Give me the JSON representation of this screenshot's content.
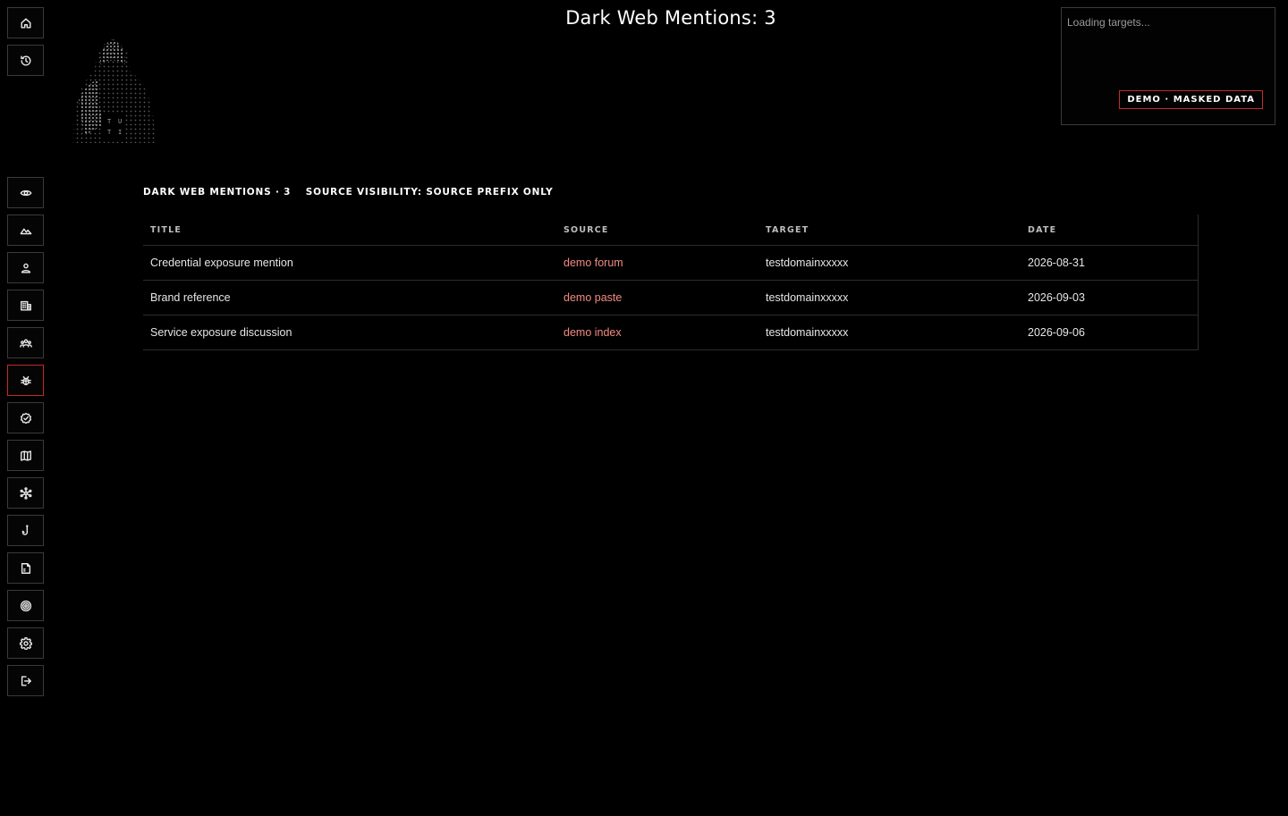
{
  "header": {
    "title": "Dark Web Mentions: 3"
  },
  "sidebar": {
    "top_items": [
      {
        "name": "home",
        "icon": "home-icon"
      },
      {
        "name": "history",
        "icon": "history-icon"
      }
    ],
    "items": [
      {
        "name": "monitoring",
        "icon": "eye-icon"
      },
      {
        "name": "landscape",
        "icon": "mountain-icon"
      },
      {
        "name": "person",
        "icon": "person-icon"
      },
      {
        "name": "organization",
        "icon": "building-icon"
      },
      {
        "name": "groups",
        "icon": "group-icon"
      },
      {
        "name": "dark-web",
        "icon": "bug-icon",
        "active": true
      },
      {
        "name": "verified",
        "icon": "verified-icon"
      },
      {
        "name": "map",
        "icon": "map-icon"
      },
      {
        "name": "network",
        "icon": "network-icon"
      },
      {
        "name": "phishing",
        "icon": "hook-icon"
      },
      {
        "name": "file",
        "icon": "file-icon"
      },
      {
        "name": "target",
        "icon": "target-icon"
      },
      {
        "name": "settings",
        "icon": "gear-icon"
      },
      {
        "name": "logout",
        "icon": "logout-icon"
      }
    ]
  },
  "logo": {
    "glyphs": [
      "T",
      "U",
      "T",
      "I"
    ]
  },
  "target_panel": {
    "loading_text": "Loading targets...",
    "badge": "DEMO · MASKED DATA"
  },
  "section": {
    "count_label": "DARK WEB MENTIONS · 3",
    "visibility_label": "SOURCE VISIBILITY: SOURCE PREFIX ONLY"
  },
  "table": {
    "headers": {
      "title": "TITLE",
      "source": "SOURCE",
      "target": "TARGET",
      "date": "DATE"
    },
    "rows": [
      {
        "title": "Credential exposure mention",
        "source": "demo forum",
        "target": "testdomainxxxxx",
        "date": "2026-08-31"
      },
      {
        "title": "Brand reference",
        "source": "demo paste",
        "target": "testdomainxxxxx",
        "date": "2026-09-03"
      },
      {
        "title": "Service exposure discussion",
        "source": "demo index",
        "target": "testdomainxxxxx",
        "date": "2026-09-06"
      }
    ]
  },
  "colors": {
    "accent": "#c42b2b",
    "source_link": "#f28b82",
    "border": "#3a3a3a",
    "background": "#000000"
  }
}
